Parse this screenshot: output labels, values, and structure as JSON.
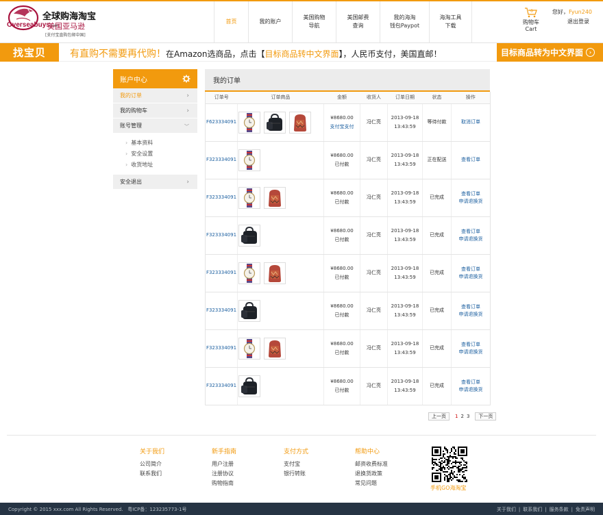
{
  "brand": {
    "title_cn": "全球购海淘宝",
    "name_en": "Overseabuys",
    "name_en_sub": ".com",
    "name_cn": "美国亚马逊",
    "tagline": "[支付宝直购包邮中国]"
  },
  "nav": [
    {
      "label": "首页"
    },
    {
      "label": "我的账户"
    },
    {
      "label": "美国购物\n导航"
    },
    {
      "label": "美国邮费\n查询"
    },
    {
      "label": "我的海淘\n钱包Paypot"
    },
    {
      "label": "海淘工具\n下载"
    }
  ],
  "cart": {
    "label_cn": "购物车",
    "label_en": "Cart",
    "count": "0"
  },
  "user": {
    "greeting": "您好，",
    "name": "Fyun240",
    "logout": "退出登录"
  },
  "banner": {
    "left": "找宝贝",
    "headline": "有直购不需要再代购！",
    "text1": "在Amazon选商品，点击【",
    "text_link": "目标商品转中文界面",
    "text2": "】，人民币支付，美国直邮！",
    "right": "目标商品转为中文界面",
    "right_icon": "arrow-right-circle-icon"
  },
  "sidebar": {
    "title": "账户中心",
    "items": [
      {
        "label": "我的订单"
      },
      {
        "label": "我的购物车"
      },
      {
        "label": "账号管理"
      }
    ],
    "sub_items": [
      "基本资料",
      "安全设置",
      "收货地址"
    ],
    "logout": "安全退出"
  },
  "main": {
    "title": "我的订单",
    "columns": [
      "订单号",
      "订单商品",
      "金额",
      "收货人",
      "订单日期",
      "状态",
      "操作"
    ],
    "orders": [
      {
        "id": "F623334091",
        "items": [
          "watch",
          "bag",
          "backpack"
        ],
        "amount": "¥8680.00",
        "pay": "支付宝支付",
        "receiver": "冯仁亮",
        "date": "2013-09-18",
        "time": "13:43:59",
        "status": "等待付款",
        "actions": [
          "取消订单"
        ]
      },
      {
        "id": "F323334091",
        "items": [
          "watch"
        ],
        "amount": "¥8680.00",
        "pay": "已付款",
        "receiver": "冯仁亮",
        "date": "2013-09-18",
        "time": "13:43:59",
        "status": "正在配送",
        "actions": [
          "查看订单"
        ]
      },
      {
        "id": "F323334091",
        "items": [
          "watch",
          "backpack"
        ],
        "amount": "¥8680.00",
        "pay": "已付款",
        "receiver": "冯仁亮",
        "date": "2013-09-18",
        "time": "13:43:59",
        "status": "已完成",
        "actions": [
          "查看订单",
          "申请退换货"
        ]
      },
      {
        "id": "F323334091",
        "items": [
          "bag"
        ],
        "amount": "¥8680.00",
        "pay": "已付款",
        "receiver": "冯仁亮",
        "date": "2013-09-18",
        "time": "13:43:59",
        "status": "已完成",
        "actions": [
          "查看订单",
          "申请退换货"
        ]
      },
      {
        "id": "F323334091",
        "items": [
          "watch",
          "backpack"
        ],
        "amount": "¥8680.00",
        "pay": "已付款",
        "receiver": "冯仁亮",
        "date": "2013-09-18",
        "time": "13:43:59",
        "status": "已完成",
        "actions": [
          "查看订单",
          "申请退换货"
        ]
      },
      {
        "id": "F323334091",
        "items": [
          "bag"
        ],
        "amount": "¥8680.00",
        "pay": "已付款",
        "receiver": "冯仁亮",
        "date": "2013-09-18",
        "time": "13:43:59",
        "status": "已完成",
        "actions": [
          "查看订单",
          "申请退换货"
        ]
      },
      {
        "id": "F323334091",
        "items": [
          "watch",
          "backpack"
        ],
        "amount": "¥8680.00",
        "pay": "已付款",
        "receiver": "冯仁亮",
        "date": "2013-09-18",
        "time": "13:43:59",
        "status": "已完成",
        "actions": [
          "查看订单",
          "申请退换货"
        ]
      },
      {
        "id": "F323334091",
        "items": [
          "bag"
        ],
        "amount": "¥8680.00",
        "pay": "已付款",
        "receiver": "冯仁亮",
        "date": "2013-09-18",
        "time": "13:43:59",
        "status": "已完成",
        "actions": [
          "查看订单",
          "申请退换货"
        ]
      }
    ]
  },
  "pager": {
    "prev": "上一页",
    "pages": [
      "1",
      "2",
      "3"
    ],
    "current": "1",
    "next": "下一页"
  },
  "footer": {
    "columns": [
      {
        "title": "关于我们",
        "links": [
          "公司简介",
          "联系我们"
        ]
      },
      {
        "title": "新手指南",
        "links": [
          "用户注册",
          "注册协议",
          "购物指南"
        ]
      },
      {
        "title": "支付方式",
        "links": [
          "支付宝",
          "银行转账"
        ]
      },
      {
        "title": "帮助中心",
        "links": [
          "邮资收费标准",
          "退换货政策",
          "常见问题"
        ]
      }
    ],
    "qr_label": "手机GO海淘宝",
    "copyright": "Copyright © 2015 xxx.com All Rights Reserved.",
    "icp": "粤ICP备：123235773-1号",
    "bottom_links": [
      "关于我们",
      "联系我们",
      "服务条款",
      "免责声明"
    ]
  },
  "colors": {
    "accent": "#f29a0e",
    "link": "#1a5e9f",
    "logo": "#a8123e",
    "footer_bg": "#263444"
  }
}
